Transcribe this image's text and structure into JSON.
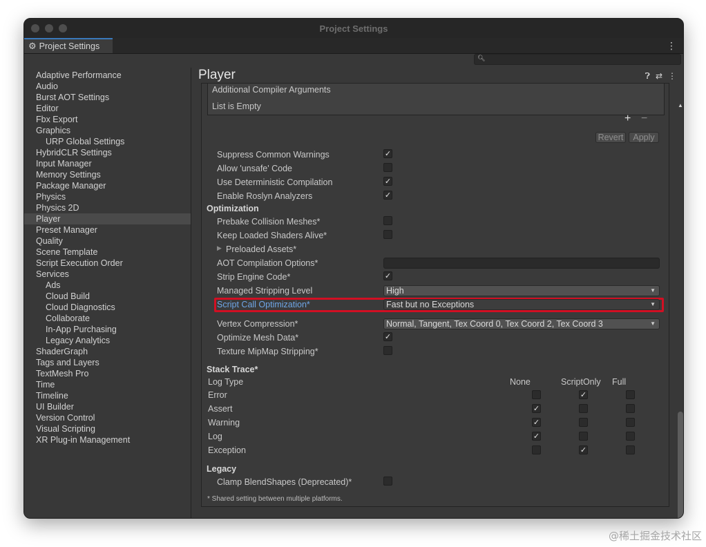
{
  "window": {
    "title": "Project Settings"
  },
  "tab": {
    "label": "Project Settings"
  },
  "sidebar": {
    "items": [
      {
        "label": "Adaptive Performance"
      },
      {
        "label": "Audio"
      },
      {
        "label": "Burst AOT Settings"
      },
      {
        "label": "Editor"
      },
      {
        "label": "Fbx Export"
      },
      {
        "label": "Graphics"
      },
      {
        "label": "URP Global Settings"
      },
      {
        "label": "HybridCLR Settings"
      },
      {
        "label": "Input Manager"
      },
      {
        "label": "Memory Settings"
      },
      {
        "label": "Package Manager"
      },
      {
        "label": "Physics"
      },
      {
        "label": "Physics 2D"
      },
      {
        "label": "Player"
      },
      {
        "label": "Preset Manager"
      },
      {
        "label": "Quality"
      },
      {
        "label": "Scene Template"
      },
      {
        "label": "Script Execution Order"
      },
      {
        "label": "Services"
      },
      {
        "label": "Ads"
      },
      {
        "label": "Cloud Build"
      },
      {
        "label": "Cloud Diagnostics"
      },
      {
        "label": "Collaborate"
      },
      {
        "label": "In-App Purchasing"
      },
      {
        "label": "Legacy Analytics"
      },
      {
        "label": "ShaderGraph"
      },
      {
        "label": "Tags and Layers"
      },
      {
        "label": "TextMesh Pro"
      },
      {
        "label": "Time"
      },
      {
        "label": "Timeline"
      },
      {
        "label": "UI Builder"
      },
      {
        "label": "Version Control"
      },
      {
        "label": "Visual Scripting"
      },
      {
        "label": "XR Plug-in Management"
      }
    ]
  },
  "main": {
    "title": "Player",
    "compiler_args": {
      "label": "Additional Compiler Arguments",
      "empty_text": "List is Empty"
    },
    "buttons": {
      "revert": "Revert",
      "apply": "Apply"
    },
    "rows": {
      "suppress_warnings": "Suppress Common Warnings",
      "allow_unsafe": "Allow 'unsafe' Code",
      "deterministic": "Use Deterministic Compilation",
      "roslyn": "Enable Roslyn Analyzers",
      "optimization_head": "Optimization",
      "prebake": "Prebake Collision Meshes*",
      "keep_shaders": "Keep Loaded Shaders Alive*",
      "preloaded": "Preloaded Assets*",
      "aot_options": "AOT Compilation Options*",
      "strip_engine": "Strip Engine Code*",
      "managed_stripping": "Managed Stripping Level",
      "managed_stripping_value": "High",
      "script_call": "Script Call Optimization*",
      "script_call_value": "Fast but no Exceptions",
      "vertex_compression": "Vertex Compression*",
      "vertex_compression_value": "Normal, Tangent, Tex Coord 0, Tex Coord 2, Tex Coord 3",
      "optimize_mesh": "Optimize Mesh Data*",
      "mipmap_strip": "Texture MipMap Stripping*",
      "stack_trace_head": "Stack Trace*",
      "log_type": "Log Type",
      "col_none": "None",
      "col_scriptonly": "ScriptOnly",
      "col_full": "Full",
      "log_error": "Error",
      "log_assert": "Assert",
      "log_warning": "Warning",
      "log_log": "Log",
      "log_exception": "Exception",
      "legacy_head": "Legacy",
      "clamp_blend": "Clamp BlendShapes (Deprecated)*",
      "footnote": "* Shared setting between multiple platforms."
    }
  },
  "watermark": "@稀土掘金技术社区",
  "colors": {
    "accent": "#3a79bb",
    "highlight": "#d20f23",
    "link": "#6fa6e6"
  },
  "icons": [
    "gear-icon",
    "menu-dots-icon",
    "search-icon",
    "help-icon",
    "sliders-icon",
    "checkmark-icon",
    "caret-down-icon",
    "foldout-arrow-icon"
  ]
}
